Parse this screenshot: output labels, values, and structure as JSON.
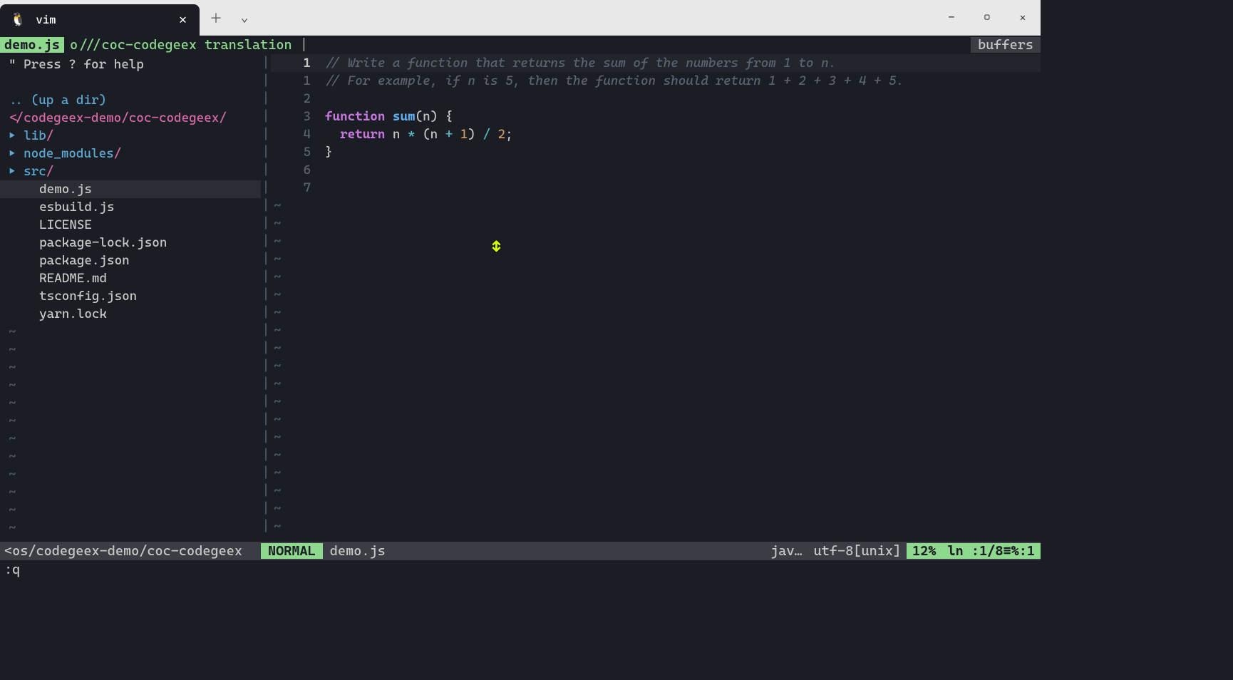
{
  "window": {
    "tab_title": "vim",
    "tab_icon": "🐧"
  },
  "topbar": {
    "filename": "demo.js",
    "path": "o///coc-codegeex translation",
    "sep": "|",
    "buffers": "buffers"
  },
  "tree": {
    "help": "\" Press ? for help",
    "updir": ".. (up a dir)",
    "root": "</codegeex-demo/coc-codegeex/",
    "folders": [
      {
        "name": "lib",
        "label": "lib/"
      },
      {
        "name": "node_modules",
        "label": "node_modules/"
      },
      {
        "name": "src",
        "label": "src/"
      }
    ],
    "files": [
      {
        "name": "demo.js",
        "selected": true
      },
      {
        "name": "esbuild.js",
        "selected": false
      },
      {
        "name": "LICENSE",
        "selected": false
      },
      {
        "name": "package-lock.json",
        "selected": false
      },
      {
        "name": "package.json",
        "selected": false
      },
      {
        "name": "README.md",
        "selected": false
      },
      {
        "name": "tsconfig.json",
        "selected": false
      },
      {
        "name": "yarn.lock",
        "selected": false
      }
    ]
  },
  "editor": {
    "current_line": "1",
    "rel_lines": [
      "1",
      "2",
      "3",
      "4",
      "5",
      "6",
      "7"
    ],
    "code": {
      "l1": "// Write a function that returns the sum of the numbers from 1 to n.",
      "l2": "// For example, if n is 5, then the function should return 1 + 2 + 3 + 4 + 5.",
      "l3_kw": "function",
      "l3_fn": "sum",
      "l3_rest": "(n) {",
      "l4_kw": "return",
      "l4_a": " n ",
      "l4_op1": "*",
      "l4_b": " (n ",
      "l4_op2": "+",
      "l4_n1": " 1",
      "l4_c": ") ",
      "l4_op3": "/",
      "l4_n2": " 2",
      "l4_d": ";",
      "l5": "}"
    }
  },
  "status": {
    "left": "<os/codegeex-demo/coc-codegeex",
    "mode": "NORMAL",
    "file": "demo.js",
    "lang": "jav…",
    "enc": "utf-8[unix]",
    "pct": "12%",
    "pos": "ln :1/8≡%:1"
  },
  "cmdline": ":q"
}
